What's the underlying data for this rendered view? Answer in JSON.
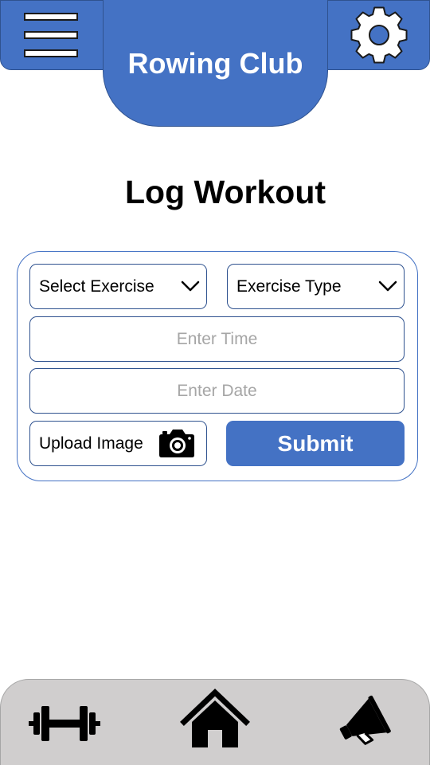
{
  "header": {
    "title": "Rowing Club",
    "menu_icon": "hamburger-menu-icon",
    "settings_icon": "gear-icon",
    "color": "#4472C4",
    "border_color": "#2F528F"
  },
  "main": {
    "page_title": "Log Workout"
  },
  "form": {
    "exercise_select": {
      "label": "Select Exercise",
      "icon": "chevron-down-icon"
    },
    "exercise_type_select": {
      "label": "Exercise Type",
      "icon": "chevron-down-icon"
    },
    "time_input": {
      "value": "",
      "placeholder": "Enter Time"
    },
    "date_input": {
      "value": "",
      "placeholder": "Enter Date"
    },
    "upload": {
      "label": "Upload Image",
      "icon": "camera-icon"
    },
    "submit_label": "Submit"
  },
  "bottom_nav": {
    "background": "#D0CECE",
    "items": [
      {
        "name": "workouts",
        "icon": "dumbbell-icon"
      },
      {
        "name": "home",
        "icon": "home-icon"
      },
      {
        "name": "announcements",
        "icon": "megaphone-icon"
      }
    ]
  }
}
